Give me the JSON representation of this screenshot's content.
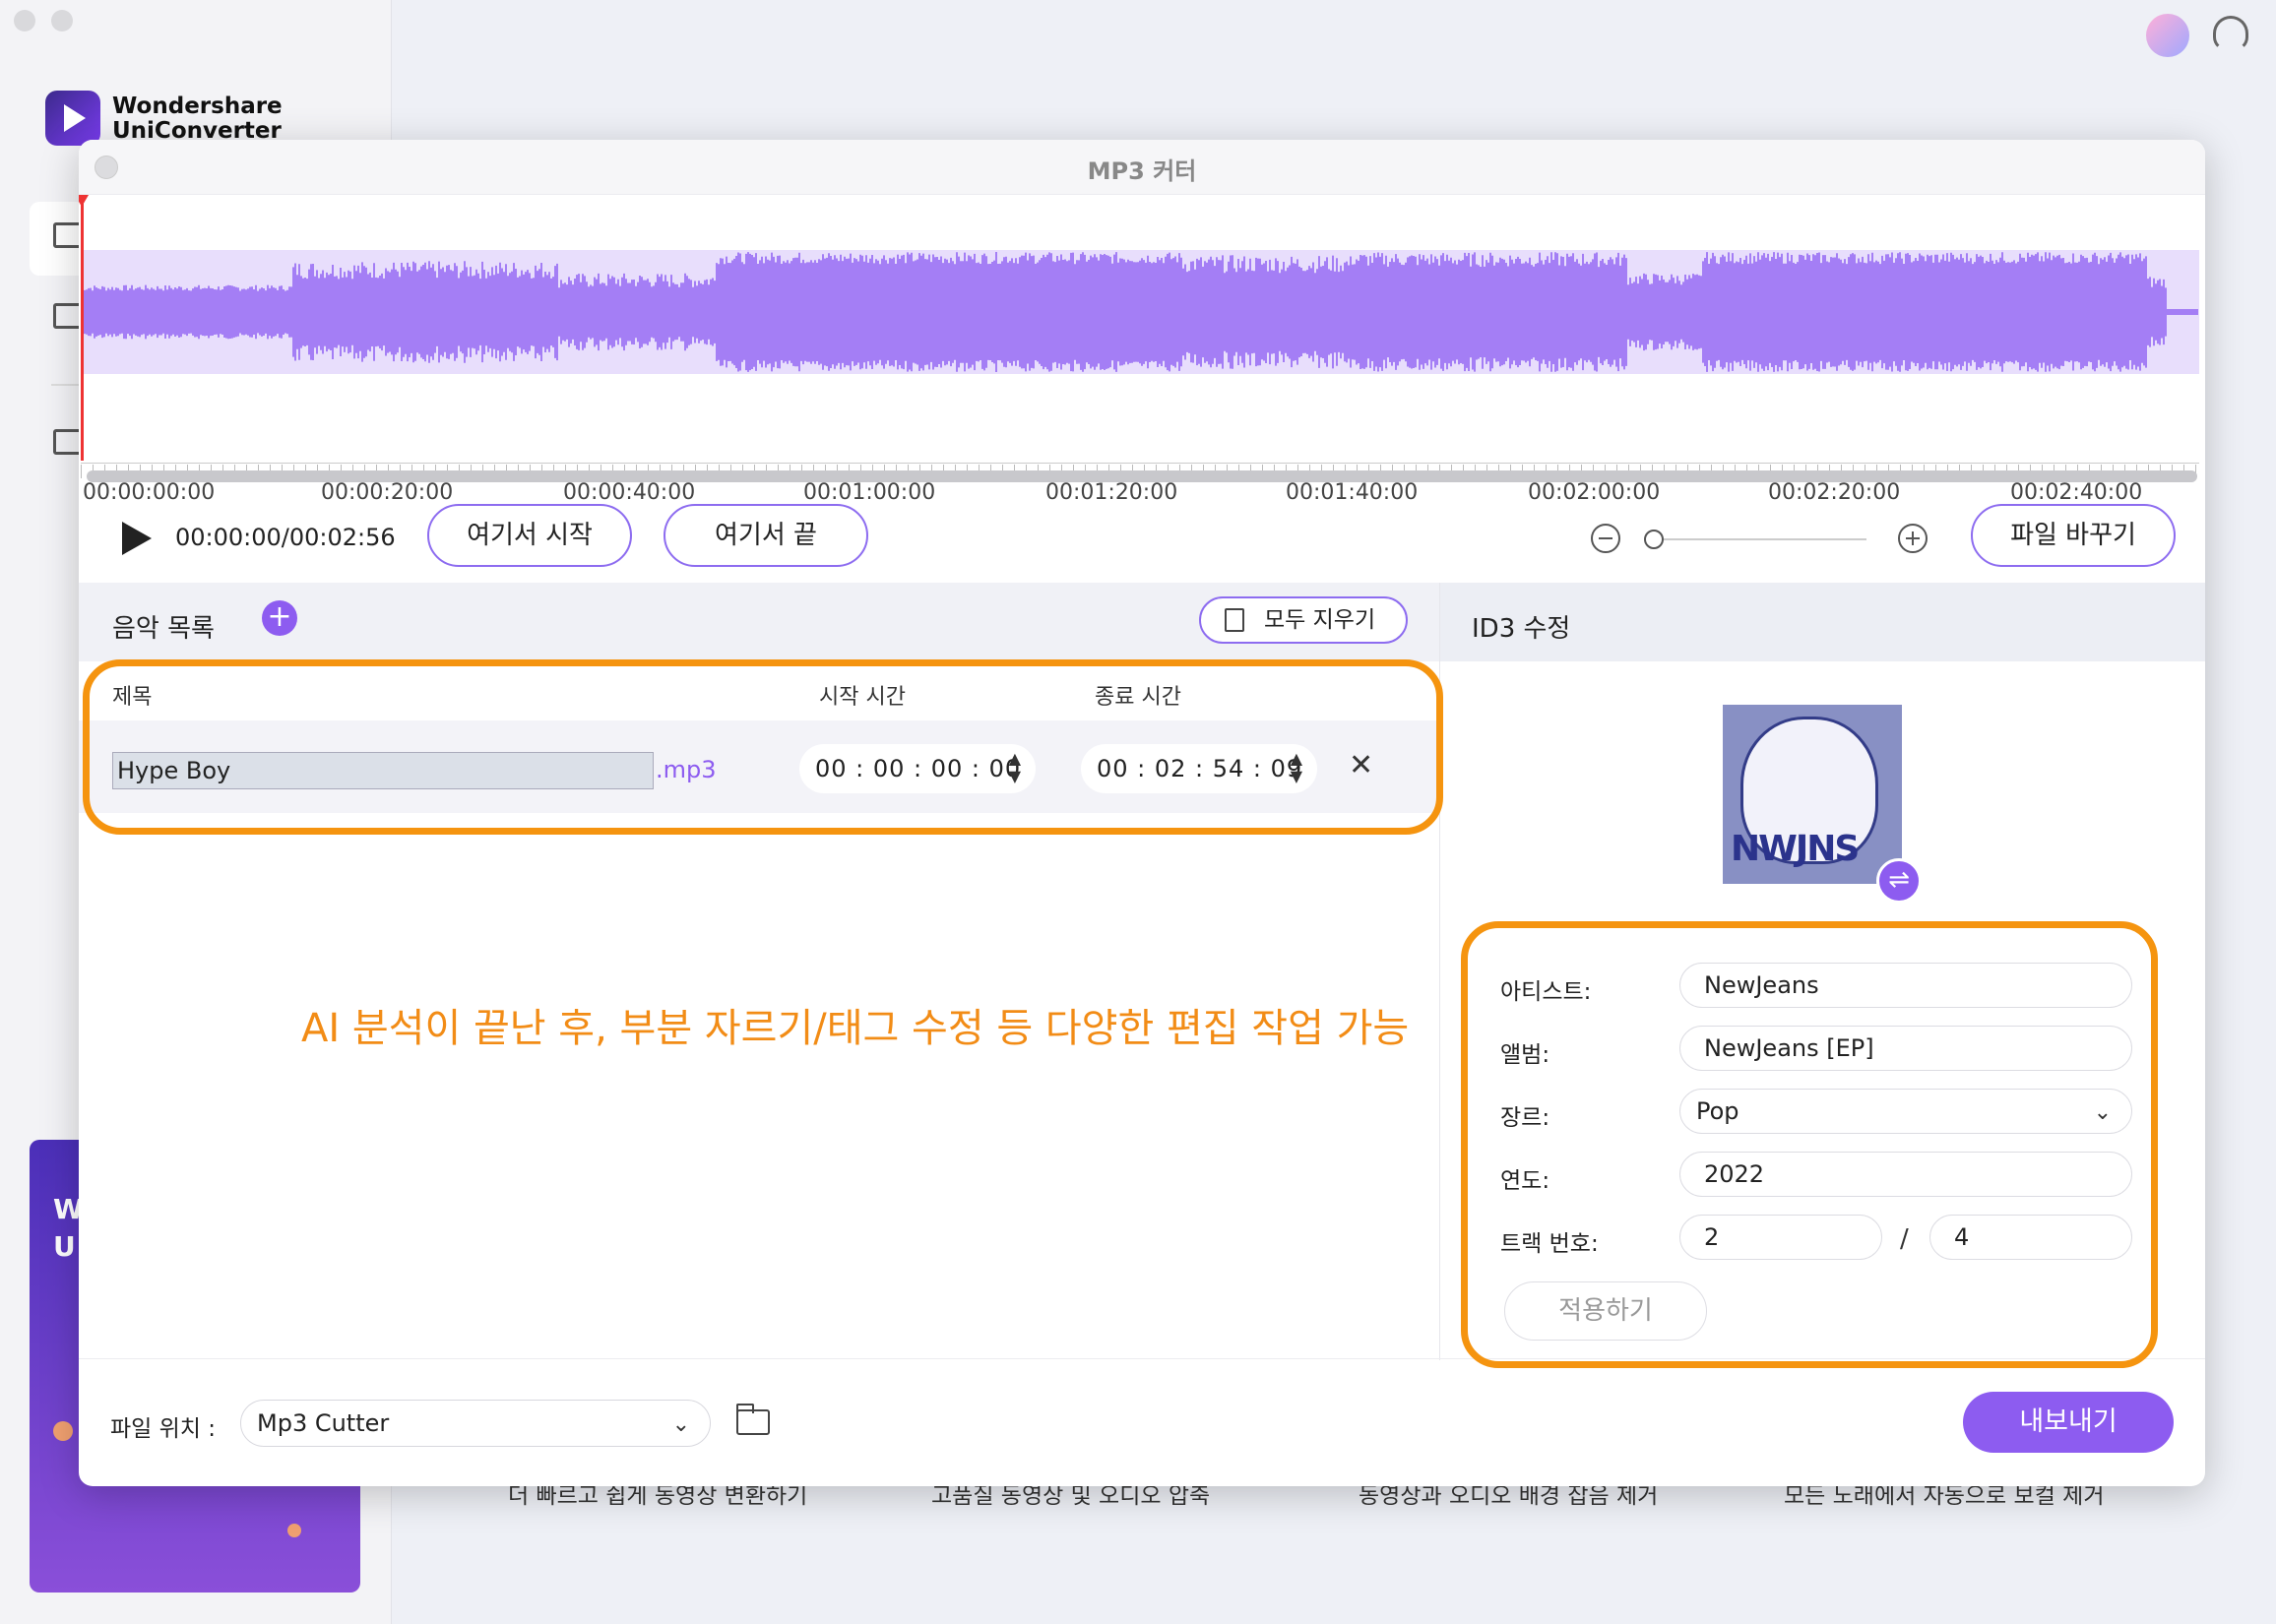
{
  "app": {
    "brand_line1": "Wondershare",
    "brand_line2": "UniConverter",
    "promo_partial": "W\nU"
  },
  "background_features": [
    "더 빠르고 쉽게 동영상 변환하기",
    "고품질 동영상 및 오디오 압축",
    "동영상과 오디오 배경 잡음 제거",
    "모든 노래에서 자동으로 보컬 제거"
  ],
  "modal": {
    "title": "MP3 커터"
  },
  "timeline": {
    "ticks": [
      "00:00:00:00",
      "00:00:20:00",
      "00:00:40:00",
      "00:01:00:00",
      "00:01:20:00",
      "00:01:40:00",
      "00:02:00:00",
      "00:02:20:00",
      "00:02:40:00"
    ],
    "waveform_color": "#a47ef5",
    "playhead_color": "#e33333"
  },
  "controls": {
    "time": "00:00:00/00:02:56",
    "start_here": "여기서 시작",
    "end_here": "여기서 끝",
    "replace_file": "파일 바꾸기"
  },
  "music_list": {
    "title": "음악 목록",
    "add_symbol": "+",
    "clear_all": "모두 지우기",
    "columns": {
      "title": "제목",
      "start": "시작 시간",
      "end": "종료 시간"
    },
    "rows": [
      {
        "title": "Hype Boy",
        "ext": ".mp3",
        "start": "00 : 00 : 00 : 00",
        "end": "00 : 02 : 54 : 09",
        "delete_symbol": "✕"
      }
    ]
  },
  "annotation": "AI 분석이 끝난 후, 부분 자르기/태그 수정 등 다양한 편집 작업 가능",
  "id3": {
    "title": "ID3 수정",
    "cover_text": "NWJNS",
    "fields": {
      "artist_label": "아티스트:",
      "artist_value": "NewJeans",
      "album_label": "앨범:",
      "album_value": "NewJeans [EP]",
      "genre_label": "장르:",
      "genre_value": "Pop",
      "year_label": "연도:",
      "year_value": "2022",
      "track_label": "트랙 번호:",
      "track_value": "2",
      "track_sep": "/",
      "track_total": "4"
    },
    "apply": "적용하기"
  },
  "footer": {
    "location_label": "파일 위치 :",
    "location_value": "Mp3 Cutter",
    "export": "내보내기"
  },
  "colors": {
    "accent": "#8d5cf0",
    "highlight": "#f5940f"
  }
}
